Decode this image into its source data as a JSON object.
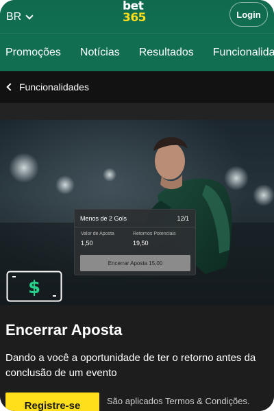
{
  "header": {
    "language": "BR",
    "logo_top": "bet",
    "logo_bottom": "365",
    "login_label": "Login"
  },
  "nav": {
    "items": [
      "Promoções",
      "Notícias",
      "Resultados",
      "Funcionalidades"
    ]
  },
  "breadcrumb": {
    "label": "Funcionalidades"
  },
  "bet_card": {
    "market": "Menos de 2 Gols",
    "odds": "12/1",
    "stake_label": "Valor de Aposta",
    "stake_value": "1,50",
    "returns_label": "Retornos Potenciais",
    "returns_value": "19,50",
    "cashout_button": "Encerrar Aposta 15,00"
  },
  "feature": {
    "icon": "cash-dollar-icon",
    "title": "Encerrar Aposta",
    "description": "Dando a você a oportunidade de ter o retorno antes da conclusão de um evento",
    "register_label": "Registre-se",
    "terms_text": "São aplicados Termos & Condições."
  },
  "colors": {
    "brand_green": "#126e51",
    "brand_yellow": "#ffdf1b",
    "cash_icon_green": "#25d08a"
  }
}
